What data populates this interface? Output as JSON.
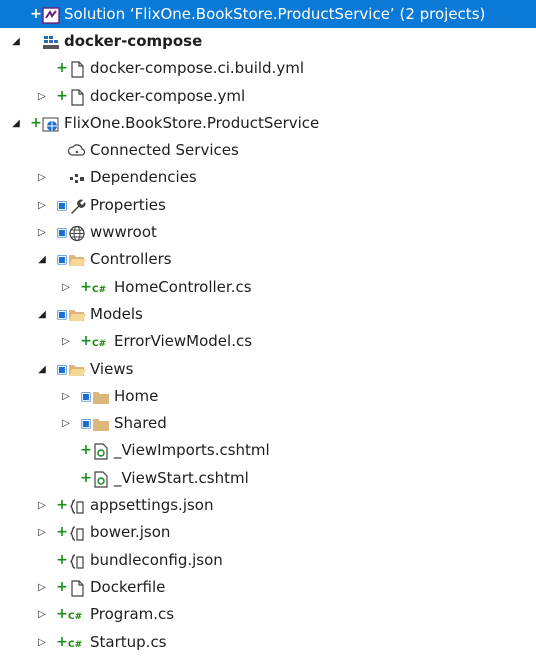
{
  "tree": [
    {
      "label": "Solution ‘FlixOne.BookStore.ProductService’ (2 projects)",
      "depth": 0,
      "expander": "none",
      "state": "add",
      "icon": "solution-icon",
      "selected": true
    },
    {
      "label": "docker-compose",
      "depth": 0,
      "expander": "expanded",
      "state": "none",
      "icon": "docker-compose-icon",
      "bold": true
    },
    {
      "label": "docker-compose.ci.build.yml",
      "depth": 1,
      "expander": "none",
      "state": "add",
      "icon": "file-icon"
    },
    {
      "label": "docker-compose.yml",
      "depth": 1,
      "expander": "collapsed",
      "state": "add",
      "icon": "file-icon"
    },
    {
      "label": "FlixOne.BookStore.ProductService",
      "depth": 0,
      "expander": "expanded",
      "state": "add",
      "icon": "web-project-icon"
    },
    {
      "label": "Connected Services",
      "depth": 1,
      "expander": "none",
      "state": "none",
      "icon": "connected-services-icon"
    },
    {
      "label": "Dependencies",
      "depth": 1,
      "expander": "collapsed",
      "state": "none",
      "icon": "dependencies-icon"
    },
    {
      "label": "Properties",
      "depth": 1,
      "expander": "collapsed",
      "state": "lock",
      "icon": "wrench-icon"
    },
    {
      "label": "wwwroot",
      "depth": 1,
      "expander": "collapsed",
      "state": "lock",
      "icon": "globe-icon"
    },
    {
      "label": "Controllers",
      "depth": 1,
      "expander": "expanded",
      "state": "lock",
      "icon": "folder-open-icon"
    },
    {
      "label": "HomeController.cs",
      "depth": 2,
      "expander": "collapsed",
      "state": "add",
      "icon": "csharp-icon"
    },
    {
      "label": "Models",
      "depth": 1,
      "expander": "expanded",
      "state": "lock",
      "icon": "folder-open-icon"
    },
    {
      "label": "ErrorViewModel.cs",
      "depth": 2,
      "expander": "collapsed",
      "state": "add",
      "icon": "csharp-icon"
    },
    {
      "label": "Views",
      "depth": 1,
      "expander": "expanded",
      "state": "lock",
      "icon": "folder-open-icon"
    },
    {
      "label": "Home",
      "depth": 2,
      "expander": "collapsed",
      "state": "lock",
      "icon": "folder-icon"
    },
    {
      "label": "Shared",
      "depth": 2,
      "expander": "collapsed",
      "state": "lock",
      "icon": "folder-icon"
    },
    {
      "label": "_ViewImports.cshtml",
      "depth": 2,
      "expander": "none",
      "state": "add",
      "icon": "razor-icon"
    },
    {
      "label": "_ViewStart.cshtml",
      "depth": 2,
      "expander": "none",
      "state": "add",
      "icon": "razor-icon"
    },
    {
      "label": "appsettings.json",
      "depth": 1,
      "expander": "collapsed",
      "state": "add",
      "icon": "json-icon"
    },
    {
      "label": "bower.json",
      "depth": 1,
      "expander": "collapsed",
      "state": "add",
      "icon": "json-icon"
    },
    {
      "label": "bundleconfig.json",
      "depth": 1,
      "expander": "none",
      "state": "add",
      "icon": "json-icon"
    },
    {
      "label": "Dockerfile",
      "depth": 1,
      "expander": "collapsed",
      "state": "add",
      "icon": "file-icon"
    },
    {
      "label": "Program.cs",
      "depth": 1,
      "expander": "collapsed",
      "state": "add",
      "icon": "csharp-icon"
    },
    {
      "label": "Startup.cs",
      "depth": 1,
      "expander": "collapsed",
      "state": "add",
      "icon": "csharp-icon"
    }
  ],
  "colors": {
    "selection": "#0b79d6",
    "pending_add": "#1b8f1b",
    "lock": "#1a6fd1",
    "folder": "#dcb67a",
    "csharp": "#178600"
  }
}
